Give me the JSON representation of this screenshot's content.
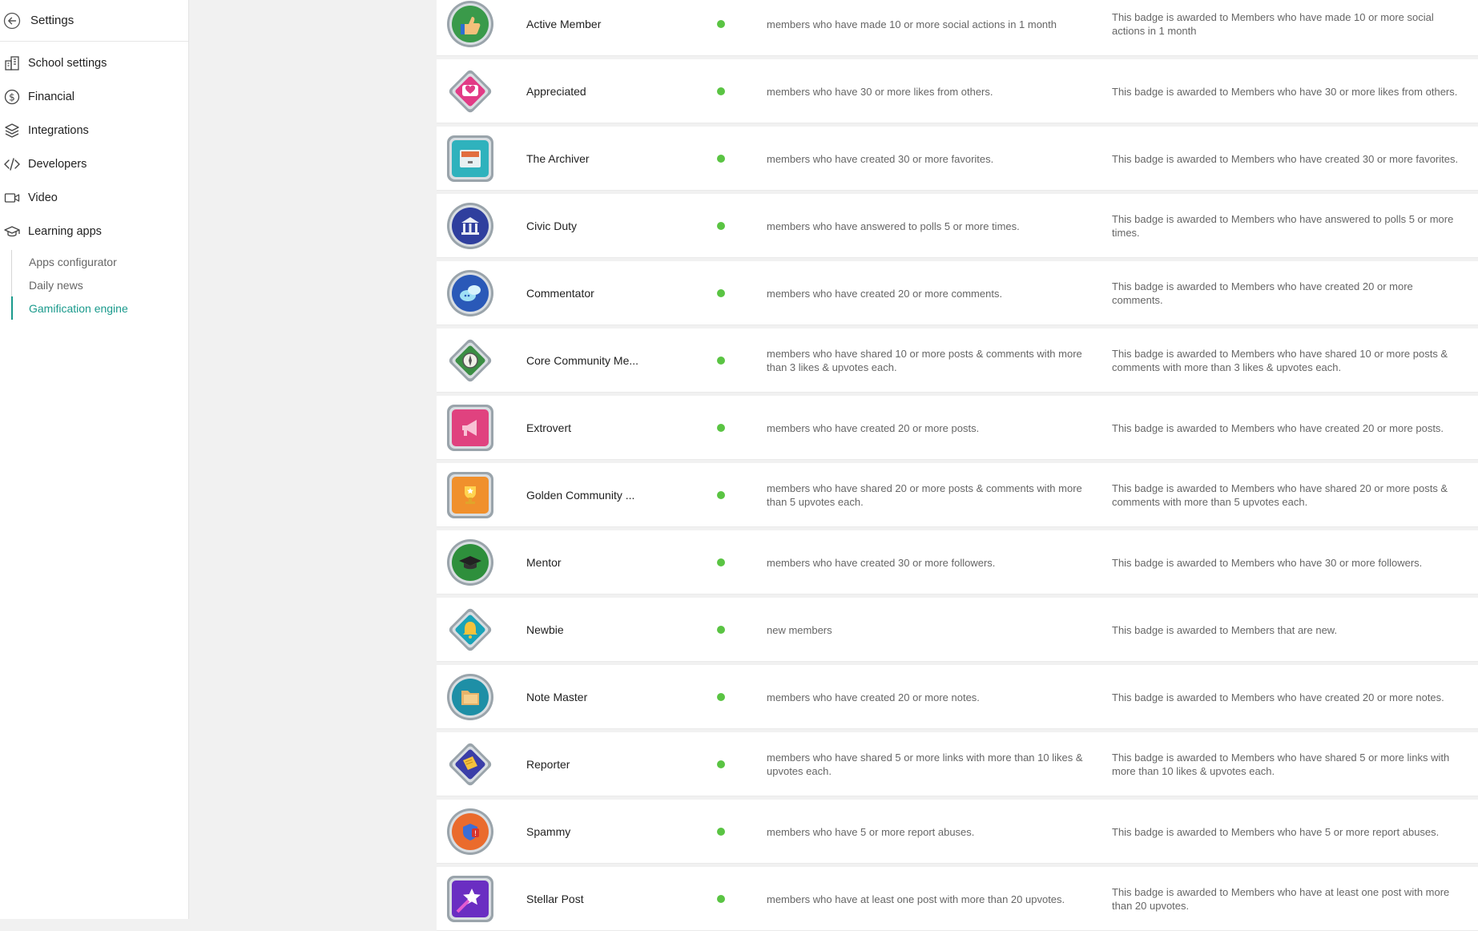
{
  "sidebar": {
    "header_title": "Settings",
    "items": [
      {
        "label": "School settings",
        "icon": "building-icon"
      },
      {
        "label": "Financial",
        "icon": "dollar-icon"
      },
      {
        "label": "Integrations",
        "icon": "layers-icon"
      },
      {
        "label": "Developers",
        "icon": "code-icon"
      },
      {
        "label": "Video",
        "icon": "video-camera-icon"
      },
      {
        "label": "Learning apps",
        "icon": "graduation-cap-icon"
      }
    ],
    "subitems": [
      {
        "label": "Apps configurator"
      },
      {
        "label": "Daily news"
      },
      {
        "label": "Gamification engine",
        "active": true
      }
    ]
  },
  "colors": {
    "accent": "#1a9a8c",
    "status_active": "#5ac443"
  },
  "badges": [
    {
      "name": "Active Member",
      "icon": "thumbs-up-badge-icon",
      "criteria": "members who have made 10 or more social actions in 1 month",
      "description": "This badge is awarded to Members who have made 10 or more social actions in 1 month"
    },
    {
      "name": "Appreciated",
      "icon": "heart-badge-icon",
      "criteria": "members who have 30 or more likes from others.",
      "description": "This badge is awarded to Members who have 30 or more likes from others."
    },
    {
      "name": "The Archiver",
      "icon": "file-cabinet-badge-icon",
      "criteria": "members who have created 30 or more favorites.",
      "description": "This badge is awarded to Members who have created 30 or more favorites."
    },
    {
      "name": "Civic Duty",
      "icon": "courthouse-badge-icon",
      "criteria": "members who have answered to polls 5 or more times.",
      "description": "This badge is awarded to Members who have answered to polls 5 or more times."
    },
    {
      "name": "Commentator",
      "icon": "speech-bubbles-badge-icon",
      "criteria": "members who have created 20 or more comments.",
      "description": "This badge is awarded to Members who have created 20 or more comments."
    },
    {
      "name": "Core Community Me...",
      "icon": "compass-badge-icon",
      "criteria": "members who have shared 10 or more posts & comments with more than 3 likes & upvotes each.",
      "description": "This badge is awarded to Members who have shared 10 or more posts & comments with more than 3 likes & upvotes each."
    },
    {
      "name": "Extrovert",
      "icon": "megaphone-badge-icon",
      "criteria": "members who have created 20 or more posts.",
      "description": "This badge is awarded to Members who have created 20 or more posts."
    },
    {
      "name": "Golden Community ...",
      "icon": "trophy-badge-icon",
      "criteria": "members who have shared 20 or more posts & comments with more than 5 upvotes each.",
      "description": "This badge is awarded to Members who have shared 20 or more posts & comments with more than 5 upvotes each."
    },
    {
      "name": "Mentor",
      "icon": "graduation-cap-badge-icon",
      "criteria": "members who have created 30 or more followers.",
      "description": "This badge is awarded to Members who have 30 or more followers."
    },
    {
      "name": "Newbie",
      "icon": "bell-badge-icon",
      "criteria": "new members",
      "description": "This badge is awarded to Members that are new."
    },
    {
      "name": "Note Master",
      "icon": "folder-badge-icon",
      "criteria": "members who have created 20 or more notes.",
      "description": "This badge is awarded to Members who have created 20 or more notes."
    },
    {
      "name": "Reporter",
      "icon": "newspaper-badge-icon",
      "criteria": "members who have shared 5 or more links with more than 10 likes & upvotes each.",
      "description": "This badge is awarded to Members who have shared 5 or more links with more than 10 likes & upvotes each."
    },
    {
      "name": "Spammy",
      "icon": "warning-shield-badge-icon",
      "criteria": "members who have 5 or more report abuses.",
      "description": "This badge is awarded to Members who have 5 or more report abuses."
    },
    {
      "name": "Stellar Post",
      "icon": "star-badge-icon",
      "criteria": "members who have at least one post with more than 20 upvotes.",
      "description": "This badge is awarded to Members who have at least one post with more than 20 upvotes."
    }
  ]
}
